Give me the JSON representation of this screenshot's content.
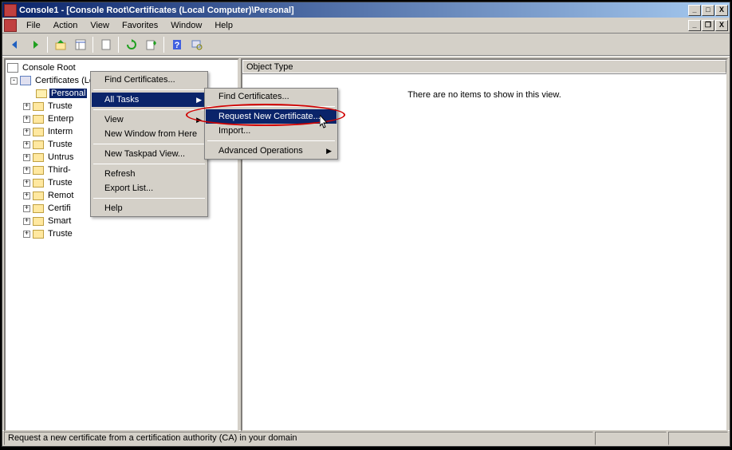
{
  "title": "Console1 - [Console Root\\Certificates (Local Computer)\\Personal]",
  "menubar": {
    "file": "File",
    "action": "Action",
    "view": "View",
    "favorites": "Favorites",
    "window": "Window",
    "help": "Help"
  },
  "tree": {
    "root": "Console Root",
    "certs": "Certificates (Local Computer)",
    "personal": "Personal",
    "items": [
      "Trusted Root Certification Authorities",
      "Enterprise Trust",
      "Intermediate Certification Authorities",
      "Trusted Publishers",
      "Untrusted Certificates",
      "Third-Party Root Certification Authorities",
      "Trusted People",
      "Remote Desktop",
      "Certificate Enrollment Requests",
      "Smart Card Trusted Roots",
      "Trusted Devices"
    ],
    "items_short": [
      "Truste",
      "Enterp",
      "Interm",
      "Truste",
      "Untrus",
      "Third-",
      "Truste",
      "Remot",
      "Certifi",
      "Smart",
      "Truste"
    ]
  },
  "list": {
    "header": "Object Type",
    "empty": "There are no items to show in this view."
  },
  "context_menu_1": {
    "find": "Find Certificates...",
    "all_tasks": "All Tasks",
    "view": "View",
    "new_window": "New Window from Here",
    "new_taskpad": "New Taskpad View...",
    "refresh": "Refresh",
    "export": "Export List...",
    "help": "Help"
  },
  "context_menu_2": {
    "find": "Find Certificates...",
    "request": "Request New Certificate...",
    "import": "Import...",
    "advanced": "Advanced Operations"
  },
  "statusbar": {
    "text": "Request a new certificate from a certification authority (CA) in your domain"
  }
}
